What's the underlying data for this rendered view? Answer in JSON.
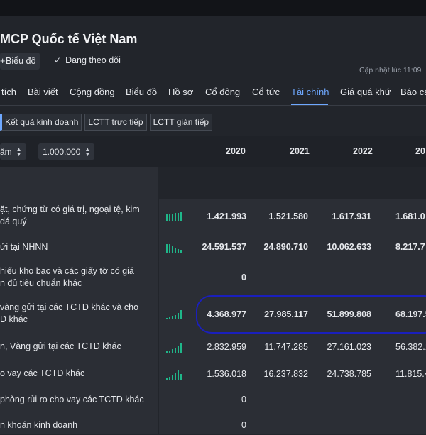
{
  "header": {
    "company_title": "MCP Quốc tế Việt Nam",
    "chart_button_label": "Biểu đồ",
    "follow_label": "Đang theo dõi",
    "updated_text": "Cập nhật lúc  11:09"
  },
  "tabs": [
    {
      "label": "tích"
    },
    {
      "label": "Bài viết"
    },
    {
      "label": "Cộng đồng"
    },
    {
      "label": "Biểu đồ"
    },
    {
      "label": "Hồ sơ"
    },
    {
      "label": "Cổ đông"
    },
    {
      "label": "Cổ tức"
    },
    {
      "label": "Tài chính"
    },
    {
      "label": "Giá quá khứ"
    },
    {
      "label": "Báo cá"
    }
  ],
  "subtabs": [
    {
      "label": "Kết quả kinh doanh"
    },
    {
      "label": "LCTT trực tiếp"
    },
    {
      "label": "LCTT gián tiếp"
    }
  ],
  "filters": {
    "period_label": "ăm",
    "unit_label": "1.000.000"
  },
  "years": [
    "2020",
    "2021",
    "2022",
    "20"
  ],
  "rows": [
    {
      "label": "ặt, chứng từ có giá trị, ngoại tệ, kim\ndá quý",
      "values": [
        "1.421.993",
        "1.521.580",
        "1.617.931",
        "1.681.0"
      ]
    },
    {
      "label": "ửi tại NHNN",
      "values": [
        "24.591.537",
        "24.890.710",
        "10.062.633",
        "8.217.7"
      ]
    },
    {
      "label": "hiếu kho bạc và các giấy tờ có giá\nn đủ tiêu chuẩn khác",
      "values": [
        "0",
        "",
        "",
        ""
      ]
    },
    {
      "label": "vàng gửi tại các TCTD khác và cho\nD khác",
      "values": [
        "4.368.977",
        "27.985.117",
        "51.899.808",
        "68.197.5"
      ]
    },
    {
      "label": "n, Vàng gửi tại các TCTD khác",
      "values": [
        "2.832.959",
        "11.747.285",
        "27.161.023",
        "56.382.1"
      ]
    },
    {
      "label": "o vay các TCTD khác",
      "values": [
        "1.536.018",
        "16.237.832",
        "24.738.785",
        "11.815.4"
      ]
    },
    {
      "label": "phòng rủi ro cho vay các TCTD khác",
      "values": [
        "0",
        "",
        "",
        ""
      ]
    },
    {
      "label": "n khoán kinh doanh",
      "values": [
        "0",
        "",
        "",
        ""
      ]
    }
  ],
  "colors": {
    "accent": "#6ea8ff",
    "spark": "#1fb78a",
    "highlight": "#1a1fbd"
  }
}
